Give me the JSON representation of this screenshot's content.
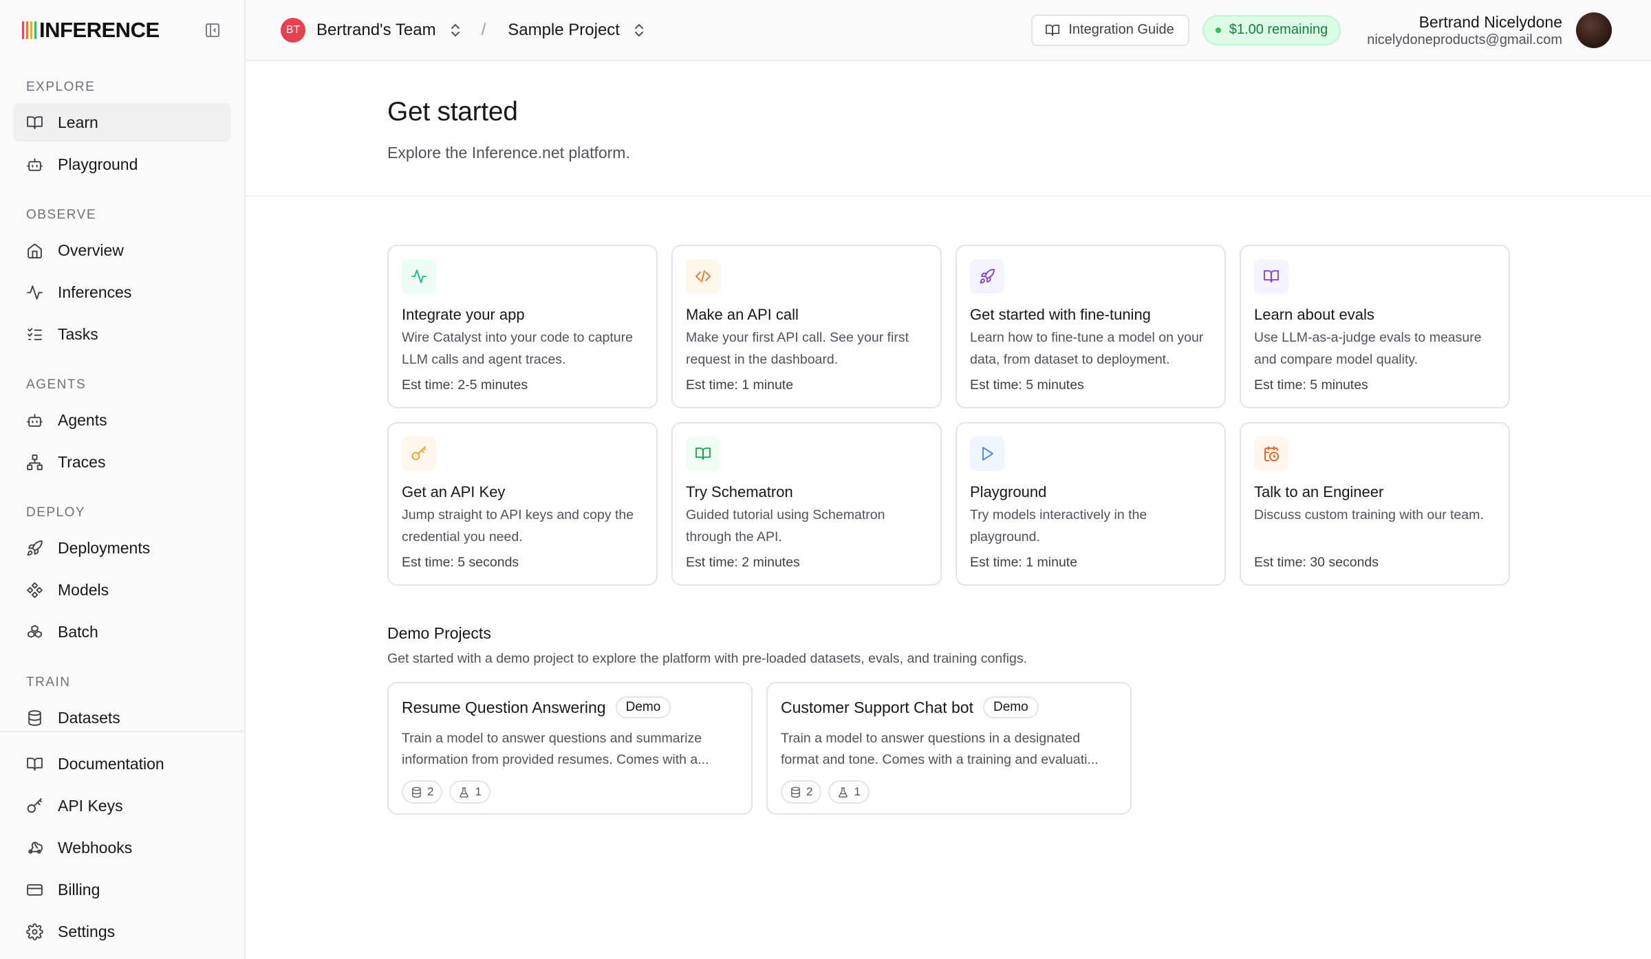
{
  "brand": {
    "name": "INFERENCE",
    "bar_colors": [
      "#f43f5e",
      "#f97316",
      "#eab308",
      "#22c55e"
    ]
  },
  "sidebar": {
    "sections": {
      "explore": "EXPLORE",
      "observe": "OBSERVE",
      "agents": "AGENTS",
      "deploy": "DEPLOY",
      "train": "TRAIN"
    },
    "items": {
      "learn": "Learn",
      "playground": "Playground",
      "overview": "Overview",
      "inferences": "Inferences",
      "tasks": "Tasks",
      "agents": "Agents",
      "traces": "Traces",
      "deployments": "Deployments",
      "models": "Models",
      "batch": "Batch",
      "datasets": "Datasets"
    },
    "bottom": {
      "documentation": "Documentation",
      "api_keys": "API Keys",
      "webhooks": "Webhooks",
      "billing": "Billing",
      "settings": "Settings"
    },
    "active_item": "Learn"
  },
  "topbar": {
    "team_initials": "BT",
    "team_name": "Bertrand's Team",
    "separator": "/",
    "project_name": "Sample Project",
    "guide_label": "Integration Guide",
    "credit_label": "$1.00 remaining",
    "user_name": "Bertrand Nicelydone",
    "user_email": "nicelydoneproducts@gmail.com"
  },
  "page": {
    "title": "Get started",
    "subtitle": "Explore the Inference.net platform."
  },
  "cards": [
    {
      "icon": "activity-icon",
      "title": "Integrate your app",
      "desc": "Wire Catalyst into your code to capture LLM calls and agent traces.",
      "time": "Est time: 2-5 minutes",
      "bg": "#ecfdf5",
      "color": "#10b981"
    },
    {
      "icon": "code-icon",
      "title": "Make an API call",
      "desc": "Make your first API call. See your first request in the dashboard.",
      "time": "Est time: 1 minute",
      "bg": "#fff7ed",
      "color": "#f97316"
    },
    {
      "icon": "rocket-icon",
      "title": "Get started with fine-tuning",
      "desc": "Learn how to fine-tune a model on your data, from dataset to deployment.",
      "time": "Est time: 5 minutes",
      "bg": "#f5f3ff",
      "color": "#7c3aed"
    },
    {
      "icon": "book-icon",
      "title": "Learn about evals",
      "desc": "Use LLM-as-a-judge evals to measure and compare model quality.",
      "time": "Est time: 5 minutes",
      "bg": "#f5f3ff",
      "color": "#7c3aed"
    },
    {
      "icon": "key-icon",
      "title": "Get an API Key",
      "desc": "Jump straight to API keys and copy the credential you need.",
      "time": "Est time: 5 seconds",
      "bg": "#fff7ed",
      "color": "#f59e0b"
    },
    {
      "icon": "book-open-icon",
      "title": "Try Schematron",
      "desc": "Guided tutorial using Schematron through the API.",
      "time": "Est time: 2 minutes",
      "bg": "#f0fdf4",
      "color": "#16a34a"
    },
    {
      "icon": "play-icon",
      "title": "Playground",
      "desc": "Try models interactively in the playground.",
      "time": "Est time: 1 minute",
      "bg": "#eff6ff",
      "color": "#3b82f6"
    },
    {
      "icon": "calendar-clock-icon",
      "title": "Talk to an Engineer",
      "desc": "Discuss custom training with our team.",
      "time": "Est time: 30 seconds",
      "bg": "#fff7ed",
      "color": "#ea580c"
    }
  ],
  "demo": {
    "title": "Demo Projects",
    "subtitle": "Get started with a demo project to explore the platform with pre-loaded datasets, evals, and training configs.",
    "projects": [
      {
        "name": "Resume Question Answering",
        "badge": "Demo",
        "desc_line1": "Train a model to answer questions and summarize",
        "desc_line2": "information from provided resumes. Comes with a...",
        "datasets": "2",
        "evals": "1"
      },
      {
        "name": "Customer Support Chat bot",
        "badge": "Demo",
        "desc_line1": "Train a model to answer questions in a designated",
        "desc_line2": "format and tone. Comes with a training and evaluati...",
        "datasets": "2",
        "evals": "1"
      }
    ]
  }
}
